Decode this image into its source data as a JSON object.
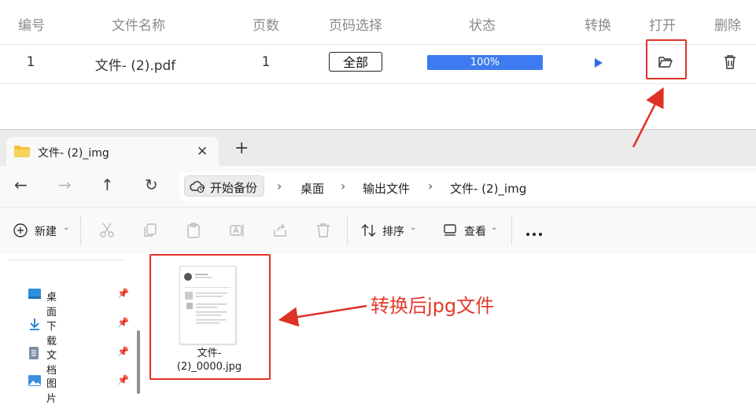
{
  "table": {
    "headers": [
      "编号",
      "文件名称",
      "页数",
      "页码选择",
      "状态",
      "转换",
      "打开",
      "删除"
    ],
    "row": {
      "index": "1",
      "file_name": "文件- (2).pdf",
      "pages": "1",
      "page_range": "全部",
      "progress_text": "100%",
      "progress_fraction": 1.0
    }
  },
  "explorer": {
    "tab_title": "文件- (2)_img",
    "backup_label": "开始备份",
    "breadcrumbs": [
      "桌面",
      "输出文件",
      "文件- (2)_img"
    ],
    "toolbar": {
      "new_label": "新建",
      "sort_label": "排序",
      "view_label": "查看"
    },
    "sidebar": [
      {
        "label": "桌面",
        "icon": "desktop-icon"
      },
      {
        "label": "下载",
        "icon": "download-icon"
      },
      {
        "label": "文档",
        "icon": "document-icon"
      },
      {
        "label": "图片",
        "icon": "picture-icon"
      }
    ],
    "file": {
      "name_line1": "文件-",
      "name_line2": "(2)_0000.jpg"
    }
  },
  "annotation": {
    "text": "转换后jpg文件",
    "color": "#e23a2c"
  },
  "colors": {
    "accent_blue": "#3e7bf0",
    "highlight_red": "#e03127",
    "folder_yellow": "#f3c13a"
  }
}
